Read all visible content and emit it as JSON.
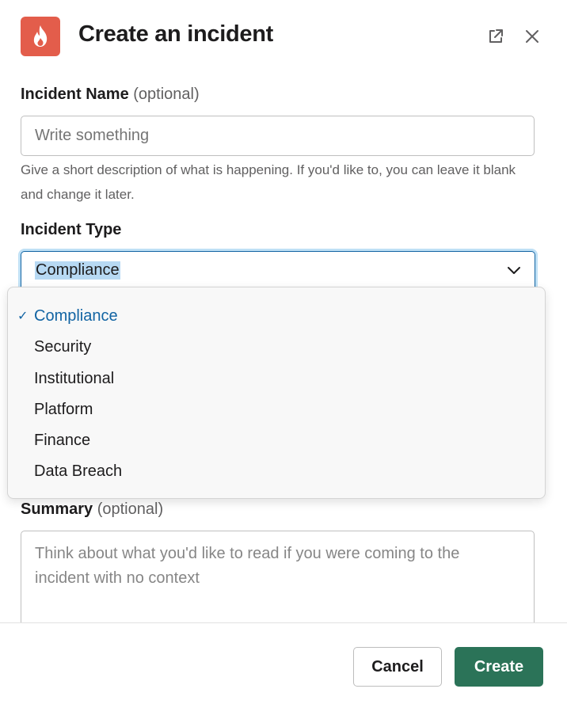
{
  "header": {
    "title": "Create an incident",
    "icon": "flame-icon",
    "accent_color": "#e35d4b"
  },
  "incident_name": {
    "label": "Incident Name",
    "optional_tag": "(optional)",
    "placeholder": "Write something",
    "value": "",
    "help_text": "Give a short description of what is happening. If you'd like to, you can leave it blank and change it later."
  },
  "incident_type": {
    "label": "Incident Type",
    "selected": "Compliance",
    "options": [
      "Compliance",
      "Security",
      "Institutional",
      "Platform",
      "Finance",
      "Data Breach"
    ]
  },
  "summary": {
    "label": "Summary",
    "optional_tag": "(optional)",
    "placeholder": "Think about what you'd like to read if you were coming to the incident with no context",
    "value": ""
  },
  "footer": {
    "cancel_label": "Cancel",
    "create_label": "Create",
    "create_color": "#2b7358"
  }
}
